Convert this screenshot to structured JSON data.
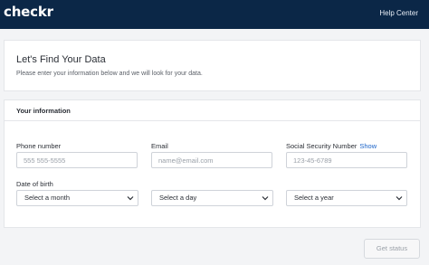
{
  "header": {
    "logo": "checkr",
    "help_link": "Help Center"
  },
  "intro": {
    "title": "Let's Find Your Data",
    "subtitle": "Please enter your information below and we will look for your data."
  },
  "form": {
    "section_title": "Your information",
    "phone": {
      "label": "Phone number",
      "placeholder": "555 555-5555"
    },
    "email": {
      "label": "Email",
      "placeholder": "name@email.com"
    },
    "ssn": {
      "label": "Social Security Number",
      "show_label": "Show",
      "placeholder": "123-45-6789"
    },
    "dob": {
      "label": "Date of birth",
      "month": "Select a month",
      "day": "Select a day",
      "year": "Select a year"
    }
  },
  "actions": {
    "get_status": "Get status"
  },
  "colors": {
    "topbar": "#0b2747",
    "link": "#1a63c8",
    "background": "#f3f4f6"
  }
}
